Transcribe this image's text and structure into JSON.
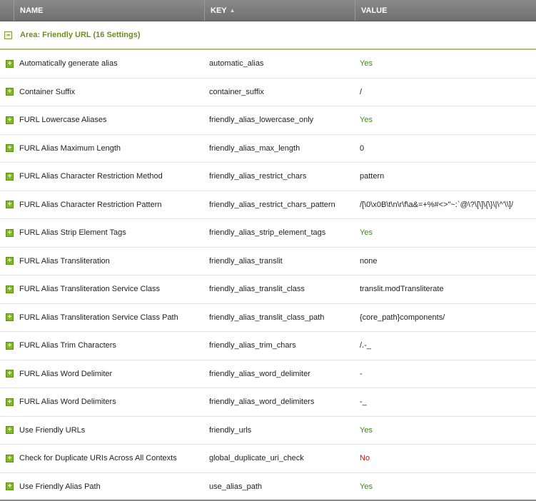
{
  "columns": {
    "name": "NAME",
    "key": "KEY",
    "value": "VALUE"
  },
  "group": {
    "toggle": "−",
    "label": "Area: Friendly URL (16 Settings)"
  },
  "rows": [
    {
      "name": "Automatically generate alias",
      "key": "automatic_alias",
      "value": "Yes"
    },
    {
      "name": "Container Suffix",
      "key": "container_suffix",
      "value": "/"
    },
    {
      "name": "FURL Lowercase Aliases",
      "key": "friendly_alias_lowercase_only",
      "value": "Yes"
    },
    {
      "name": "FURL Alias Maximum Length",
      "key": "friendly_alias_max_length",
      "value": "0"
    },
    {
      "name": "FURL Alias Character Restriction Method",
      "key": "friendly_alias_restrict_chars",
      "value": "pattern"
    },
    {
      "name": "FURL Alias Character Restriction Pattern",
      "key": "friendly_alias_restrict_chars_pattern",
      "value": "/[\\0\\x0B\\t\\n\\r\\f\\a&=+%#<>\"~:`@\\?\\[\\]\\{\\}\\|\\^'\\\\]/"
    },
    {
      "name": "FURL Alias Strip Element Tags",
      "key": "friendly_alias_strip_element_tags",
      "value": "Yes"
    },
    {
      "name": "FURL Alias Transliteration",
      "key": "friendly_alias_translit",
      "value": "none"
    },
    {
      "name": "FURL Alias Transliteration Service Class",
      "key": "friendly_alias_translit_class",
      "value": "translit.modTransliterate"
    },
    {
      "name": "FURL Alias Transliteration Service Class Path",
      "key": "friendly_alias_translit_class_path",
      "value": "{core_path}components/"
    },
    {
      "name": "FURL Alias Trim Characters",
      "key": "friendly_alias_trim_chars",
      "value": "/.-_"
    },
    {
      "name": "FURL Alias Word Delimiter",
      "key": "friendly_alias_word_delimiter",
      "value": "-"
    },
    {
      "name": "FURL Alias Word Delimiters",
      "key": "friendly_alias_word_delimiters",
      "value": "-_"
    },
    {
      "name": "Use Friendly URLs",
      "key": "friendly_urls",
      "value": "Yes"
    },
    {
      "name": "Check for Duplicate URIs Across All Contexts",
      "key": "global_duplicate_uri_check",
      "value": "No"
    },
    {
      "name": "Use Friendly Alias Path",
      "key": "use_alias_path",
      "value": "Yes"
    }
  ],
  "icons": {
    "expand": "plus-icon",
    "collapse": "minus-icon",
    "sort": "sort-arrow-icon"
  },
  "colors": {
    "yes": "#3c8a10",
    "no": "#d01010",
    "group": "#6a8f1e",
    "expander": "#7fb728"
  }
}
